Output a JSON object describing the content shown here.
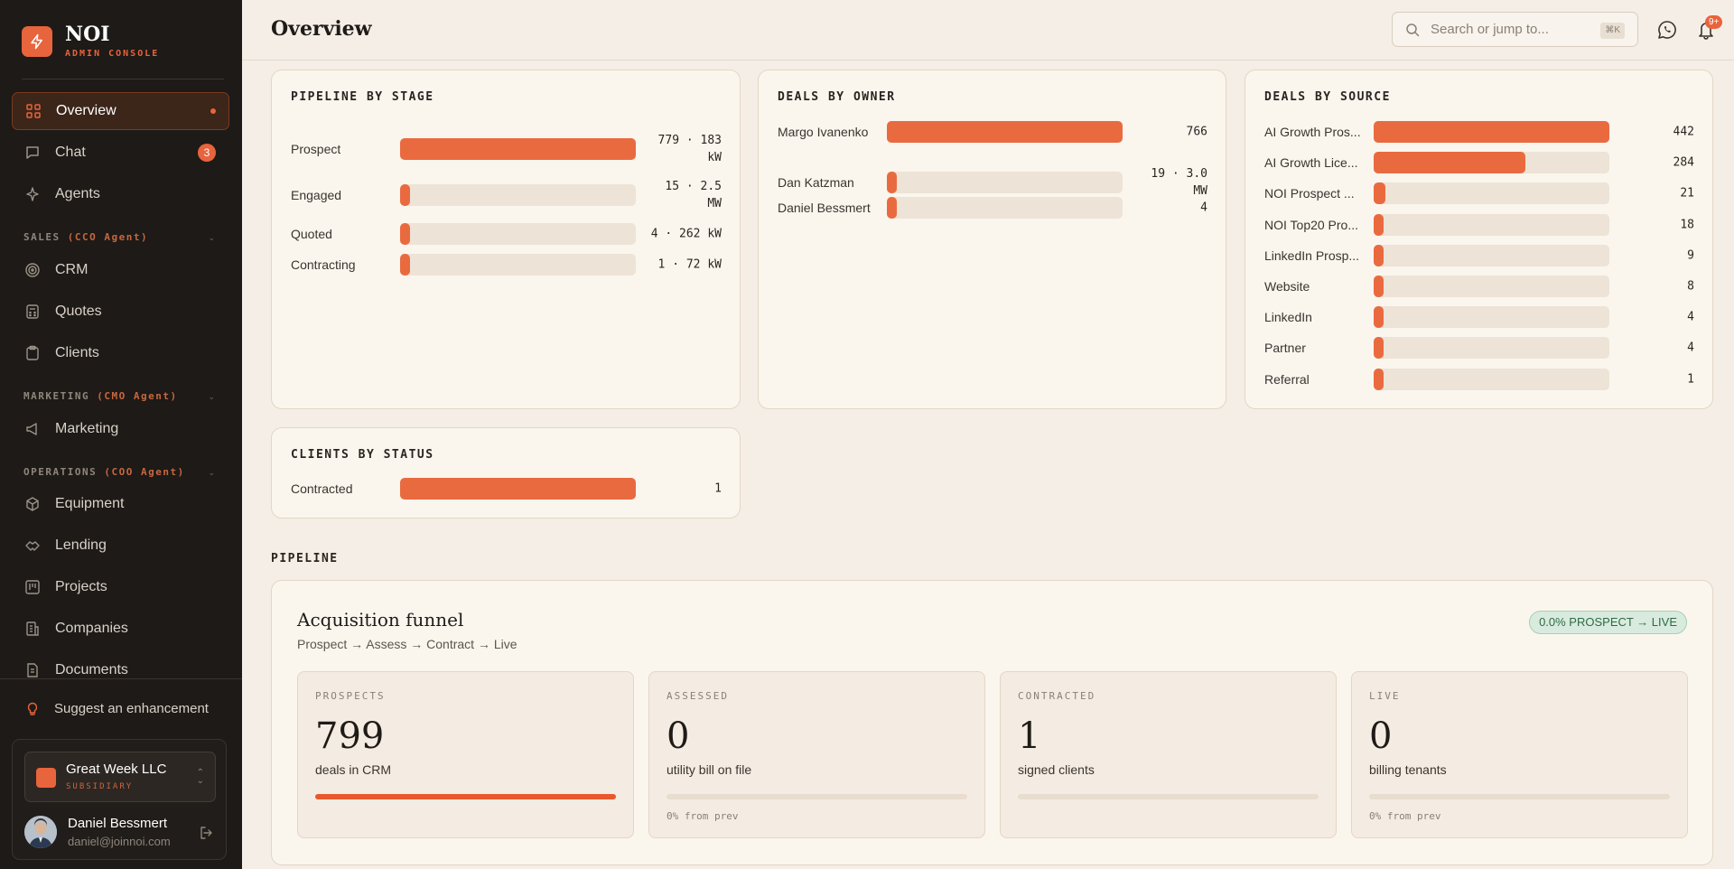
{
  "brand": {
    "name": "NOI",
    "subtitle": "ADMIN CONSOLE",
    "accent": "#e8643c"
  },
  "sidebar": {
    "items": [
      {
        "label": "Overview",
        "icon": "grid-icon",
        "active": true,
        "dot": true
      },
      {
        "label": "Chat",
        "icon": "chat-icon",
        "badge": "3"
      },
      {
        "label": "Agents",
        "icon": "sparkle-icon"
      },
      {
        "label": "CRM",
        "icon": "target-icon"
      },
      {
        "label": "Quotes",
        "icon": "calculator-icon"
      },
      {
        "label": "Clients",
        "icon": "clipboard-icon"
      },
      {
        "label": "Marketing",
        "icon": "megaphone-icon"
      },
      {
        "label": "Equipment",
        "icon": "box-icon"
      },
      {
        "label": "Lending",
        "icon": "handshake-icon"
      },
      {
        "label": "Projects",
        "icon": "kanban-icon"
      },
      {
        "label": "Companies",
        "icon": "building-icon"
      },
      {
        "label": "Documents",
        "icon": "document-icon"
      }
    ],
    "sections": [
      {
        "label": "SALES",
        "agent": "(CCO Agent)"
      },
      {
        "label": "MARKETING",
        "agent": "(CMO Agent)"
      },
      {
        "label": "OPERATIONS",
        "agent": "(COO Agent)"
      }
    ],
    "suggest": "Suggest an enhancement",
    "company": {
      "name": "Great Week LLC",
      "type": "SUBSIDIARY"
    },
    "user": {
      "name": "Daniel Bessmert",
      "email": "daniel@joinnoi.com"
    }
  },
  "topbar": {
    "title": "Overview",
    "search_placeholder": "Search or jump to...",
    "shortcut": "⌘K",
    "notif_badge": "9+"
  },
  "pipeline_by_stage": {
    "title": "PIPELINE BY STAGE",
    "rows": [
      {
        "label": "Prospect",
        "value": "779 · 183 kW",
        "fraction": 1.0
      },
      {
        "label": "Engaged",
        "value": "15 · 2.5 MW",
        "fraction": 0.02
      },
      {
        "label": "Quoted",
        "value": "4 · 262 kW",
        "fraction": 0.01
      },
      {
        "label": "Contracting",
        "value": "1 · 72 kW",
        "fraction": 0.005
      }
    ]
  },
  "deals_by_owner": {
    "title": "DEALS BY OWNER",
    "rows": [
      {
        "label": "Margo Ivanenko",
        "value": "766",
        "fraction": 1.0
      },
      {
        "label": "Dan Katzman",
        "value": "19 · 3.0 MW",
        "fraction": 0.025
      },
      {
        "label": "Daniel Bessmert",
        "value": "4",
        "fraction": 0.005
      }
    ]
  },
  "deals_by_source": {
    "title": "DEALS BY SOURCE",
    "rows": [
      {
        "label": "AI Growth Pros...",
        "value": "442",
        "fraction": 1.0
      },
      {
        "label": "AI Growth Lice...",
        "value": "284",
        "fraction": 0.643
      },
      {
        "label": "NOI Prospect ...",
        "value": "21",
        "fraction": 0.048
      },
      {
        "label": "NOI Top20 Pro...",
        "value": "18",
        "fraction": 0.041
      },
      {
        "label": "LinkedIn Prosp...",
        "value": "9",
        "fraction": 0.02
      },
      {
        "label": "Website",
        "value": "8",
        "fraction": 0.018
      },
      {
        "label": "LinkedIn",
        "value": "4",
        "fraction": 0.009
      },
      {
        "label": "Partner",
        "value": "4",
        "fraction": 0.009
      },
      {
        "label": "Referral",
        "value": "1",
        "fraction": 0.002
      }
    ]
  },
  "clients_by_status": {
    "title": "CLIENTS BY STATUS",
    "rows": [
      {
        "label": "Contracted",
        "value": "1",
        "fraction": 1.0
      }
    ]
  },
  "pipeline_section": "PIPELINE",
  "funnel": {
    "title": "Acquisition funnel",
    "subtitle": "Prospect → Assess → Contract → Live",
    "conversion": "0.0% PROSPECT → LIVE",
    "stages": [
      {
        "label": "PROSPECTS",
        "value": "799",
        "desc": "deals in CRM",
        "progress": 1.0,
        "foot": ""
      },
      {
        "label": "ASSESSED",
        "value": "0",
        "desc": "utility bill on file",
        "progress": 0,
        "foot": "0% from prev"
      },
      {
        "label": "CONTRACTED",
        "value": "1",
        "desc": "signed clients",
        "progress": 0,
        "foot": ""
      },
      {
        "label": "LIVE",
        "value": "0",
        "desc": "billing tenants",
        "progress": 0,
        "foot": "0% from prev"
      }
    ]
  }
}
